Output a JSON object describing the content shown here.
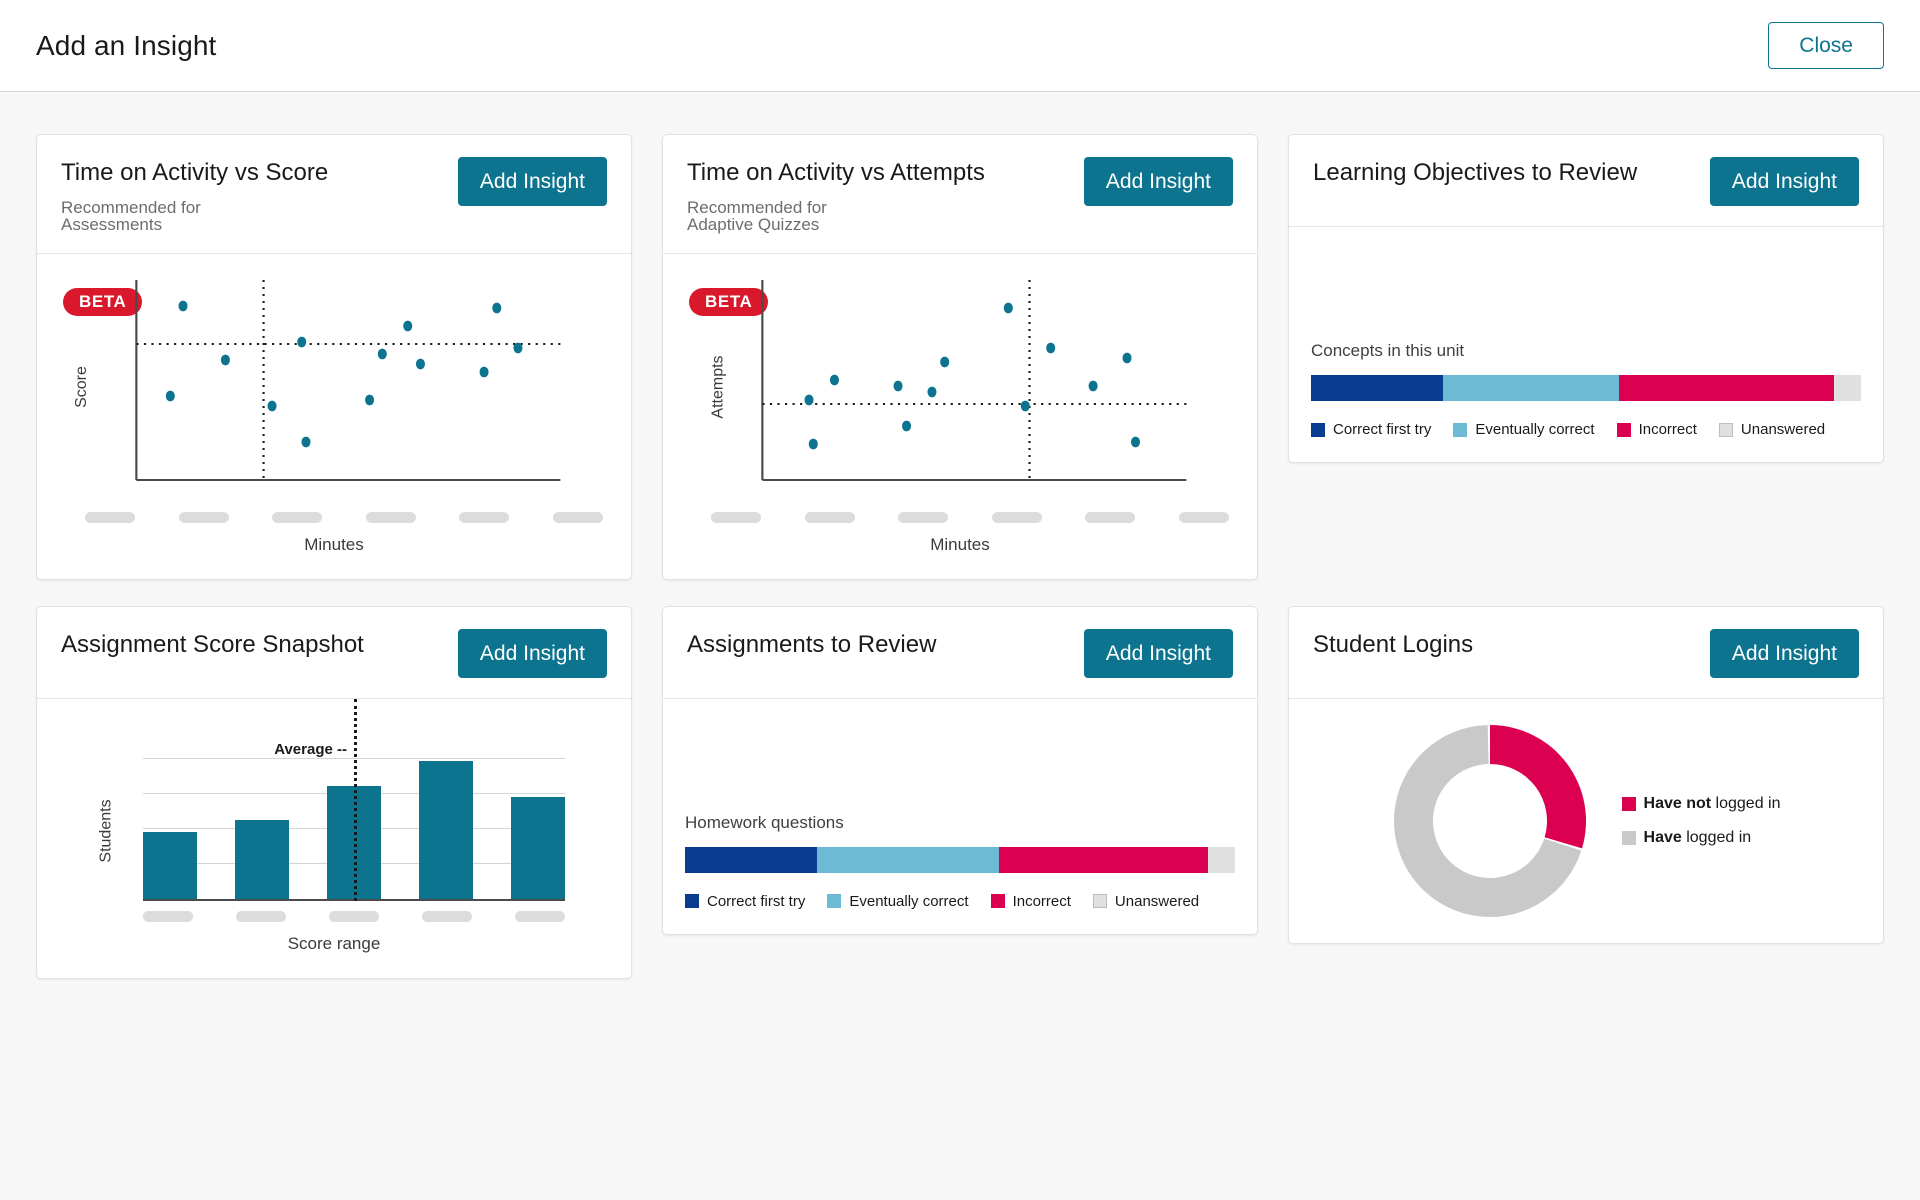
{
  "header": {
    "title": "Add an Insight",
    "close_label": "Close"
  },
  "common": {
    "add_insight_label": "Add Insight",
    "beta_label": "BETA"
  },
  "colors": {
    "teal": "#0d7490",
    "dark_blue": "#0a3d91",
    "light_blue": "#6dbad4",
    "crimson": "#db0050",
    "gray": "#c9c9c9",
    "light_gray": "#e0e0e0",
    "beta_red": "#d9182c"
  },
  "cards": [
    {
      "title": "Time on Activity vs Score",
      "subtitle": "Recommended for\nAssessments",
      "button": "Add Insight",
      "badge": "BETA"
    },
    {
      "title": "Time on Activity vs Attempts",
      "subtitle": "Recommended for\nAdaptive Quizzes",
      "button": "Add Insight",
      "badge": "BETA"
    },
    {
      "title": "Learning Objectives to Review",
      "button": "Add Insight"
    },
    {
      "title": "Assignment Score Snapshot",
      "button": "Add Insight"
    },
    {
      "title": "Assignments to Review",
      "button": "Add Insight"
    },
    {
      "title": "Student Logins",
      "button": "Add Insight"
    }
  ],
  "chart_data": [
    {
      "type": "scatter",
      "title": "Time on Activity vs Score",
      "xlabel": "Minutes",
      "ylabel": "Score",
      "xlim": [
        0,
        100
      ],
      "ylim": [
        0,
        100
      ],
      "grid": false,
      "reference_lines": {
        "horizontal_y": 68,
        "vertical_x": 30
      },
      "marker_color": "#0d7490",
      "tick_labels_hidden": true,
      "tick_count": 6,
      "points": [
        {
          "x": 11,
          "y": 87
        },
        {
          "x": 8,
          "y": 42
        },
        {
          "x": 21,
          "y": 60
        },
        {
          "x": 32,
          "y": 37
        },
        {
          "x": 39,
          "y": 69
        },
        {
          "x": 40,
          "y": 19
        },
        {
          "x": 55,
          "y": 40
        },
        {
          "x": 58,
          "y": 63
        },
        {
          "x": 64,
          "y": 77
        },
        {
          "x": 67,
          "y": 58
        },
        {
          "x": 82,
          "y": 54
        },
        {
          "x": 85,
          "y": 86
        },
        {
          "x": 90,
          "y": 66
        }
      ]
    },
    {
      "type": "scatter",
      "title": "Time on Activity vs Attempts",
      "xlabel": "Minutes",
      "ylabel": "Attempts",
      "xlim": [
        0,
        100
      ],
      "ylim": [
        0,
        100
      ],
      "grid": false,
      "reference_lines": {
        "horizontal_y": 38,
        "vertical_x": 63
      },
      "marker_color": "#0d7490",
      "tick_labels_hidden": true,
      "tick_count": 6,
      "points": [
        {
          "x": 11,
          "y": 40
        },
        {
          "x": 12,
          "y": 18
        },
        {
          "x": 17,
          "y": 50
        },
        {
          "x": 32,
          "y": 47
        },
        {
          "x": 34,
          "y": 27
        },
        {
          "x": 40,
          "y": 44
        },
        {
          "x": 43,
          "y": 59
        },
        {
          "x": 58,
          "y": 86
        },
        {
          "x": 62,
          "y": 37
        },
        {
          "x": 68,
          "y": 66
        },
        {
          "x": 78,
          "y": 47
        },
        {
          "x": 86,
          "y": 61
        },
        {
          "x": 88,
          "y": 19
        }
      ]
    },
    {
      "type": "bar",
      "title": "Learning Objectives to Review",
      "subtype": "stacked-100",
      "caption": "Concepts in this unit",
      "categories": [
        "Correct first try",
        "Eventually correct",
        "Incorrect",
        "Unanswered"
      ],
      "values": [
        24,
        32,
        39,
        5
      ],
      "colors": [
        "#0a3d91",
        "#6dbad4",
        "#db0050",
        "#e0e0e0"
      ],
      "legend_position": "bottom"
    },
    {
      "type": "bar",
      "title": "Assignment Score Snapshot",
      "xlabel": "Score range",
      "ylabel": "Students",
      "categories": [
        "",
        "",
        "",
        "",
        ""
      ],
      "values": [
        38,
        45,
        64,
        78,
        58
      ],
      "ylim": [
        0,
        100
      ],
      "grid": true,
      "gridline_count": 4,
      "bar_color": "#0d7490",
      "tick_labels_hidden": true,
      "annotation": {
        "label": "Average --",
        "at_category_fraction": 0.5
      }
    },
    {
      "type": "bar",
      "title": "Assignments to Review",
      "subtype": "stacked-100",
      "caption": "Homework questions",
      "categories": [
        "Correct first try",
        "Eventually correct",
        "Incorrect",
        "Unanswered"
      ],
      "values": [
        24,
        33,
        38,
        5
      ],
      "colors": [
        "#0a3d91",
        "#6dbad4",
        "#db0050",
        "#e0e0e0"
      ],
      "legend_position": "bottom"
    },
    {
      "type": "pie",
      "subtype": "donut",
      "title": "Student Logins",
      "labels": [
        "Have not logged in",
        "Have logged in"
      ],
      "legend_bold_prefix": [
        "Have not",
        "Have"
      ],
      "legend_rest": [
        " logged in",
        " logged in"
      ],
      "values": [
        30,
        70
      ],
      "colors": [
        "#db0050",
        "#c9c9c9"
      ],
      "legend_position": "right"
    }
  ]
}
